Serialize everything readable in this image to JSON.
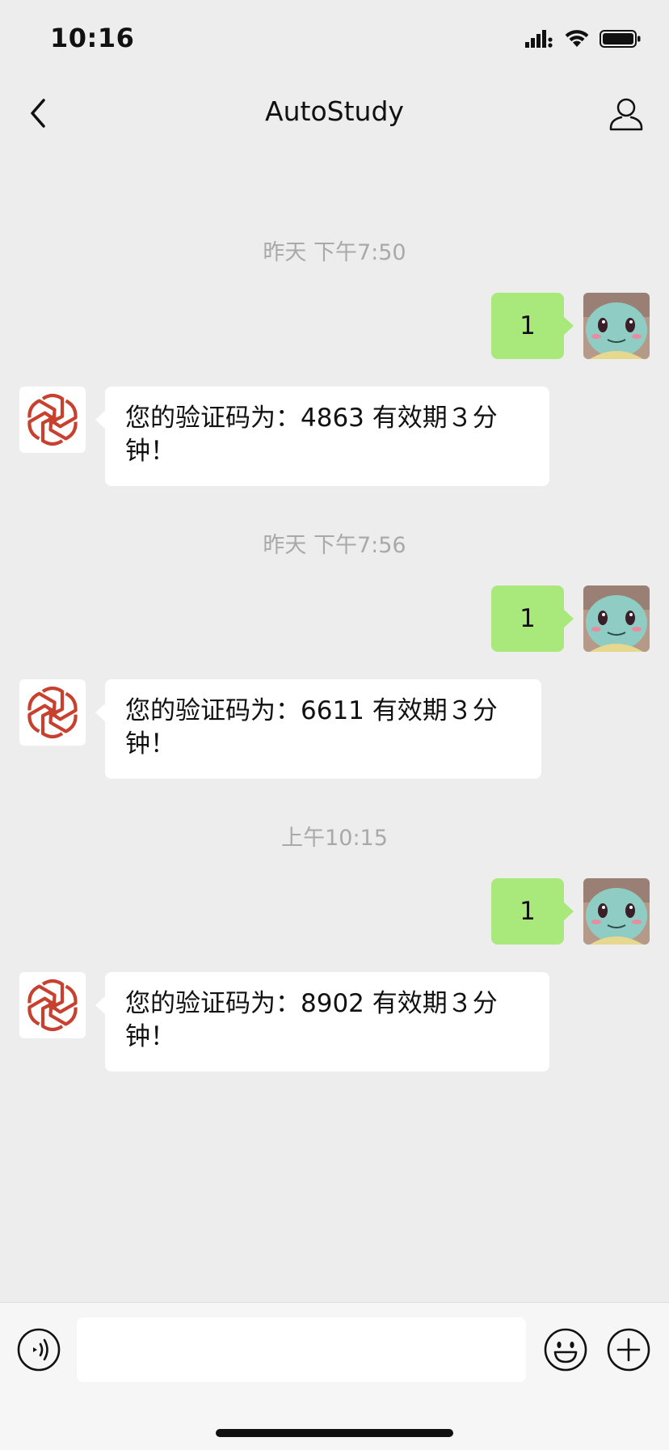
{
  "status_bar": {
    "time": "10:16"
  },
  "header": {
    "title": "AutoStudy",
    "back_icon": "chevron-left-icon",
    "profile_icon": "person-icon"
  },
  "messages": [
    {
      "type": "timestamp",
      "text": "昨天 下午7:50"
    },
    {
      "type": "sent",
      "text": "1",
      "avatar": "squirtle-avatar"
    },
    {
      "type": "received",
      "text": "您的验证码为：4863 有效期３分钟！",
      "avatar": "openai-logo-avatar"
    },
    {
      "type": "timestamp",
      "text": "昨天 下午7:56"
    },
    {
      "type": "sent",
      "text": "1",
      "avatar": "squirtle-avatar"
    },
    {
      "type": "received",
      "text": "您的验证码为：6611 有效期３分钟！",
      "avatar": "openai-logo-avatar"
    },
    {
      "type": "timestamp",
      "text": "上午10:15"
    },
    {
      "type": "sent",
      "text": "1",
      "avatar": "squirtle-avatar"
    },
    {
      "type": "received",
      "text": "您的验证码为：8902 有效期３分钟！",
      "avatar": "openai-logo-avatar"
    }
  ],
  "input_bar": {
    "value": "",
    "placeholder": "",
    "icons": [
      "voice-icon",
      "emoji-icon",
      "plus-icon"
    ]
  },
  "colors": {
    "background": "#ededed",
    "sent_bubble": "#a9e97c",
    "received_bubble": "#ffffff",
    "logo_red": "#c8412e"
  }
}
